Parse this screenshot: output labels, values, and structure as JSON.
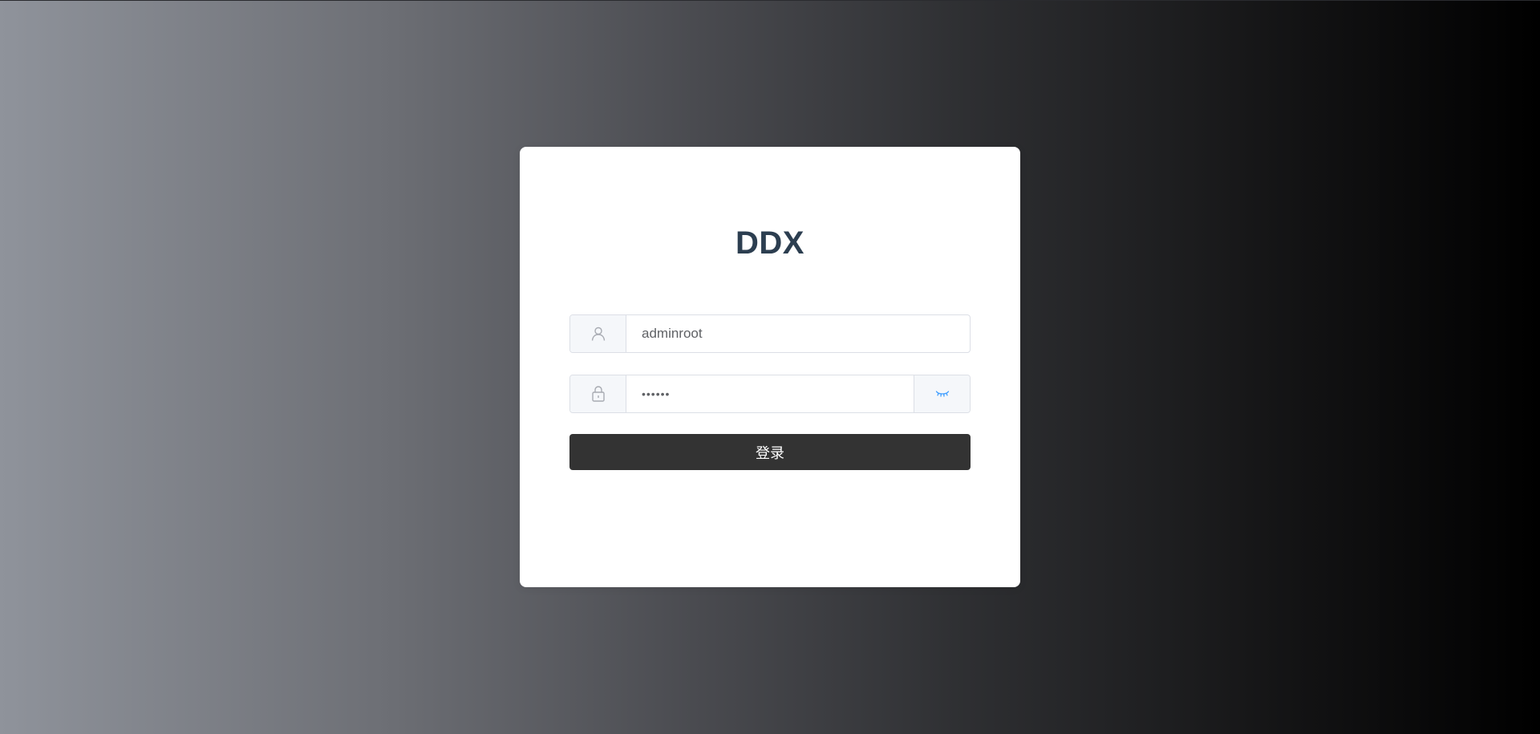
{
  "login": {
    "title": "DDX",
    "username": {
      "icon": "user-icon",
      "value": "adminroot"
    },
    "password": {
      "icon": "lock-icon",
      "value": "••••••",
      "toggle_icon": "eye-closed-icon"
    },
    "submit_label": "登录"
  },
  "colors": {
    "title": "#2c3e50",
    "button_bg": "#333333",
    "eye_icon": "#409eff",
    "field_icon": "#a8abb2"
  }
}
